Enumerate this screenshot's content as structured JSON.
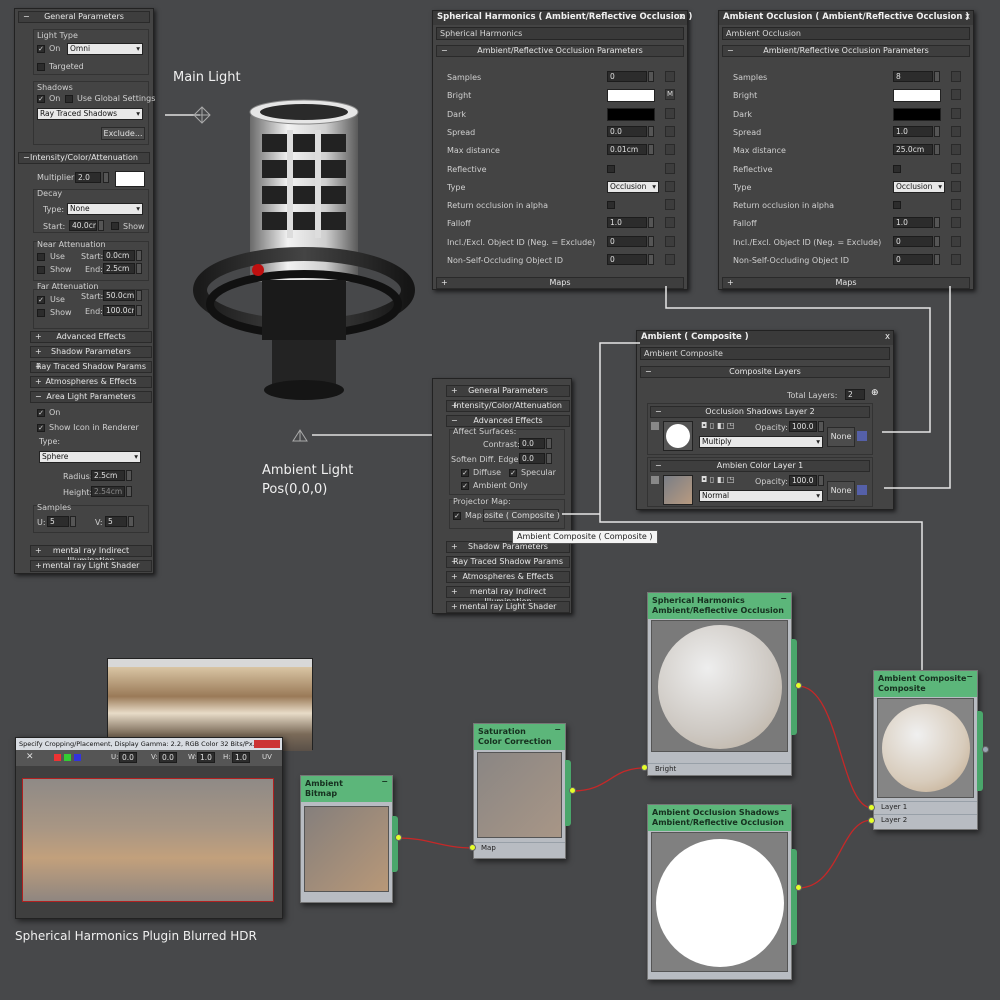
{
  "captions": {
    "main_light": "Main Light",
    "ambient_light_line1": "Ambient Light",
    "ambient_light_line2": "Pos(0,0,0)",
    "hdr": "Spherical Harmonics Plugin Blurred HDR"
  },
  "left_panel": {
    "general_params": "General Parameters",
    "light_type": "Light Type",
    "on": "On",
    "light_type_value": "Omni",
    "targeted": "Targeted",
    "shadows": "Shadows",
    "shadows_on": "On",
    "use_global": "Use Global Settings",
    "shadow_type": "Ray Traced Shadows",
    "exclude": "Exclude...",
    "intensity": "Intensity/Color/Attenuation",
    "multiplier_label": "Multiplier:",
    "multiplier": "2.0",
    "decay": "Decay",
    "type_label": "Type:",
    "decay_type": "None",
    "start_label": "Start:",
    "decay_start": "40.0cm",
    "show": "Show",
    "near_att": "Near Attenuation",
    "use": "Use",
    "near_start": "0.0cm",
    "end_label": "End:",
    "near_end": "2.5cm",
    "far_att": "Far Attenuation",
    "far_start": "50.0cm",
    "far_end": "100.0cm",
    "advanced_effects": "Advanced Effects",
    "shadow_params": "Shadow Parameters",
    "rt_shadow_params": "Ray Traced Shadow Params",
    "atmospheres": "Atmospheres & Effects",
    "area_light": "Area Light Parameters",
    "area_on": "On",
    "show_icon": "Show Icon in Renderer",
    "area_type": "Type:",
    "area_type_value": "Sphere",
    "radius_label": "Radius:",
    "radius": "2.5cm",
    "height_label": "Height:",
    "height": "2.54cm",
    "samples": "Samples",
    "u_label": "U:",
    "u": "5",
    "v_label": "V:",
    "v": "5",
    "mr_indirect": "mental ray Indirect Illumination",
    "mr_light_shader": "mental ray Light Shader"
  },
  "sh_panel": {
    "title": "Spherical Harmonics  ( Ambient/Reflective Occlusion )",
    "name": "Spherical Harmonics",
    "section": "Ambient/Reflective Occlusion Parameters",
    "rows": [
      {
        "label": "Samples",
        "value": "0"
      },
      {
        "label": "Bright",
        "value": ""
      },
      {
        "label": "Dark",
        "value": ""
      },
      {
        "label": "Spread",
        "value": "0.0"
      },
      {
        "label": "Max distance",
        "value": "0.01cm"
      },
      {
        "label": "Reflective",
        "value": ""
      },
      {
        "label": "Type",
        "value": "Occlusion"
      },
      {
        "label": "Return occlusion in alpha",
        "value": ""
      },
      {
        "label": "Falloff",
        "value": "1.0"
      },
      {
        "label": "Incl./Excl. Object ID (Neg. = Exclude)",
        "value": "0"
      },
      {
        "label": "Non-Self-Occluding Object ID",
        "value": "0"
      }
    ],
    "m": "M",
    "maps": "Maps"
  },
  "ao_panel": {
    "title": "Ambient Occlusion  ( Ambient/Reflective Occlusion )",
    "name": "Ambient Occlusion",
    "section": "Ambient/Reflective Occlusion Parameters",
    "rows": [
      {
        "label": "Samples",
        "value": "8"
      },
      {
        "label": "Bright",
        "value": ""
      },
      {
        "label": "Dark",
        "value": ""
      },
      {
        "label": "Spread",
        "value": "1.0"
      },
      {
        "label": "Max distance",
        "value": "25.0cm"
      },
      {
        "label": "Reflective",
        "value": ""
      },
      {
        "label": "Type",
        "value": "Occlusion"
      },
      {
        "label": "Return occlusion in alpha",
        "value": ""
      },
      {
        "label": "Falloff",
        "value": "1.0"
      },
      {
        "label": "Incl./Excl. Object ID (Neg. = Exclude)",
        "value": "0"
      },
      {
        "label": "Non-Self-Occluding Object ID",
        "value": "0"
      }
    ],
    "maps": "Maps"
  },
  "composite_panel": {
    "title": "Ambient      ( Composite )",
    "name": "Ambient Composite",
    "section": "Composite Layers",
    "total_layers_label": "Total Layers:",
    "total_layers": "2",
    "layer2_title": "Occlusion Shadows Layer 2",
    "opacity_label": "Opacity:",
    "layer2_opacity": "100.0",
    "layer2_mode": "Multiply",
    "none": "None",
    "layer1_title": "Ambien Color Layer 1",
    "layer1_opacity": "100.0",
    "layer1_mode": "Normal"
  },
  "mid_panel": {
    "general": "General Parameters",
    "intensity": "Intensity/Color/Attenuation",
    "advanced": "Advanced Effects",
    "affect_surfaces": "Affect Surfaces:",
    "contrast_label": "Contrast:",
    "contrast": "0.0",
    "soften_label": "Soften Diff. Edge:",
    "soften": "0.0",
    "diffuse": "Diffuse",
    "specular": "Specular",
    "ambient_only": "Ambient Only",
    "projector_map": "Projector Map:",
    "map_label": "Map:",
    "map_value": "osite  ( Composite )",
    "tooltip": "Ambient Composite  ( Composite )",
    "shadow_params": "Shadow Parameters",
    "rt_shadow": "Ray Traced Shadow Params",
    "atmos": "Atmospheres & Effects",
    "mr_indirect": "mental ray Indirect Illumination",
    "mr_shader": "mental ray Light Shader"
  },
  "hdr_window": {
    "title": "Specify Cropping/Placement, Display Gamma: 2.2, RGB Color 32 Bits/Px...",
    "u_label": "U:",
    "u": "0.0",
    "v_label": "V:",
    "v": "0.0",
    "w_label": "W:",
    "w": "1.0",
    "h_label": "H:",
    "h": "1.0",
    "uv": "UV"
  },
  "nodes": {
    "bitmap": {
      "line1": "Ambient",
      "line2": "Bitmap"
    },
    "saturation": {
      "line1": "Saturation",
      "line2": "Color Correction",
      "slot": "Map"
    },
    "sh": {
      "line1": "Spherical Harmonics",
      "line2": "Ambient/Reflective Occlusion",
      "slot": "Bright"
    },
    "ao": {
      "line1": "Ambient Occlusion Shadows",
      "line2": "Ambient/Reflective Occlusion"
    },
    "composite": {
      "line1": "Ambient Composite",
      "line2": "Composite",
      "slot1": "Layer 1",
      "slot2": "Layer 2"
    }
  },
  "colors": {
    "node_header": "#5cb67a",
    "socket": "#e6ff2a",
    "wire": "#c62828",
    "background": "#47484a"
  }
}
